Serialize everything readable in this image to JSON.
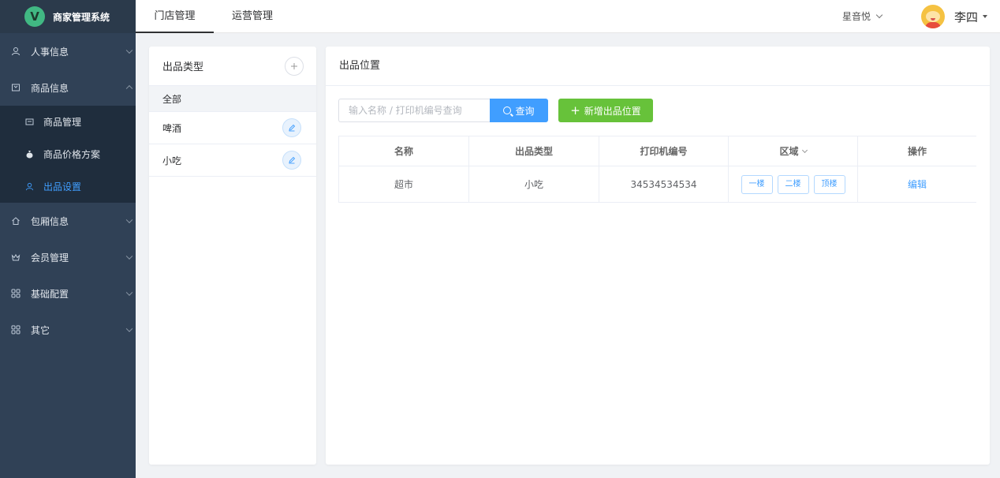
{
  "app": {
    "logo_letter": "V",
    "title": "商家管理系统"
  },
  "sidebar": {
    "items": [
      {
        "label": "人事信息",
        "icon": "user-icon"
      },
      {
        "label": "商品信息",
        "icon": "product-icon",
        "expanded": true,
        "children": [
          {
            "label": "商品管理",
            "icon": "product-manage-icon"
          },
          {
            "label": "商品价格方案",
            "icon": "money-bag-icon"
          },
          {
            "label": "出品设置",
            "icon": "user-icon",
            "active": true
          }
        ]
      },
      {
        "label": "包厢信息",
        "icon": "home-icon"
      },
      {
        "label": "会员管理",
        "icon": "crown-icon"
      },
      {
        "label": "基础配置",
        "icon": "grid-icon"
      },
      {
        "label": "其它",
        "icon": "grid-icon"
      }
    ]
  },
  "header": {
    "tabs": [
      {
        "label": "门店管理",
        "active": true
      },
      {
        "label": "运营管理",
        "active": false
      }
    ],
    "store": "星音悦",
    "user": "李四"
  },
  "left_panel": {
    "title": "出品类型",
    "categories": [
      {
        "label": "全部",
        "active": true
      },
      {
        "label": "啤酒"
      },
      {
        "label": "小吃"
      }
    ]
  },
  "right_panel": {
    "title": "出品位置",
    "search": {
      "placeholder": "输入名称 / 打印机编号查询",
      "button": "查询"
    },
    "add_button": "新增出品位置",
    "table": {
      "headers": [
        "名称",
        "出品类型",
        "打印机编号",
        "区域",
        "操作"
      ],
      "rows": [
        {
          "name": "超市",
          "type": "小吃",
          "printer": "34534534534",
          "areas": [
            "一楼",
            "二楼",
            "顶楼"
          ],
          "action": "编辑"
        }
      ]
    }
  },
  "colors": {
    "primary": "#409eff",
    "success": "#67c23a",
    "sidebar": "#304156",
    "submenu": "#1f2d3d"
  }
}
